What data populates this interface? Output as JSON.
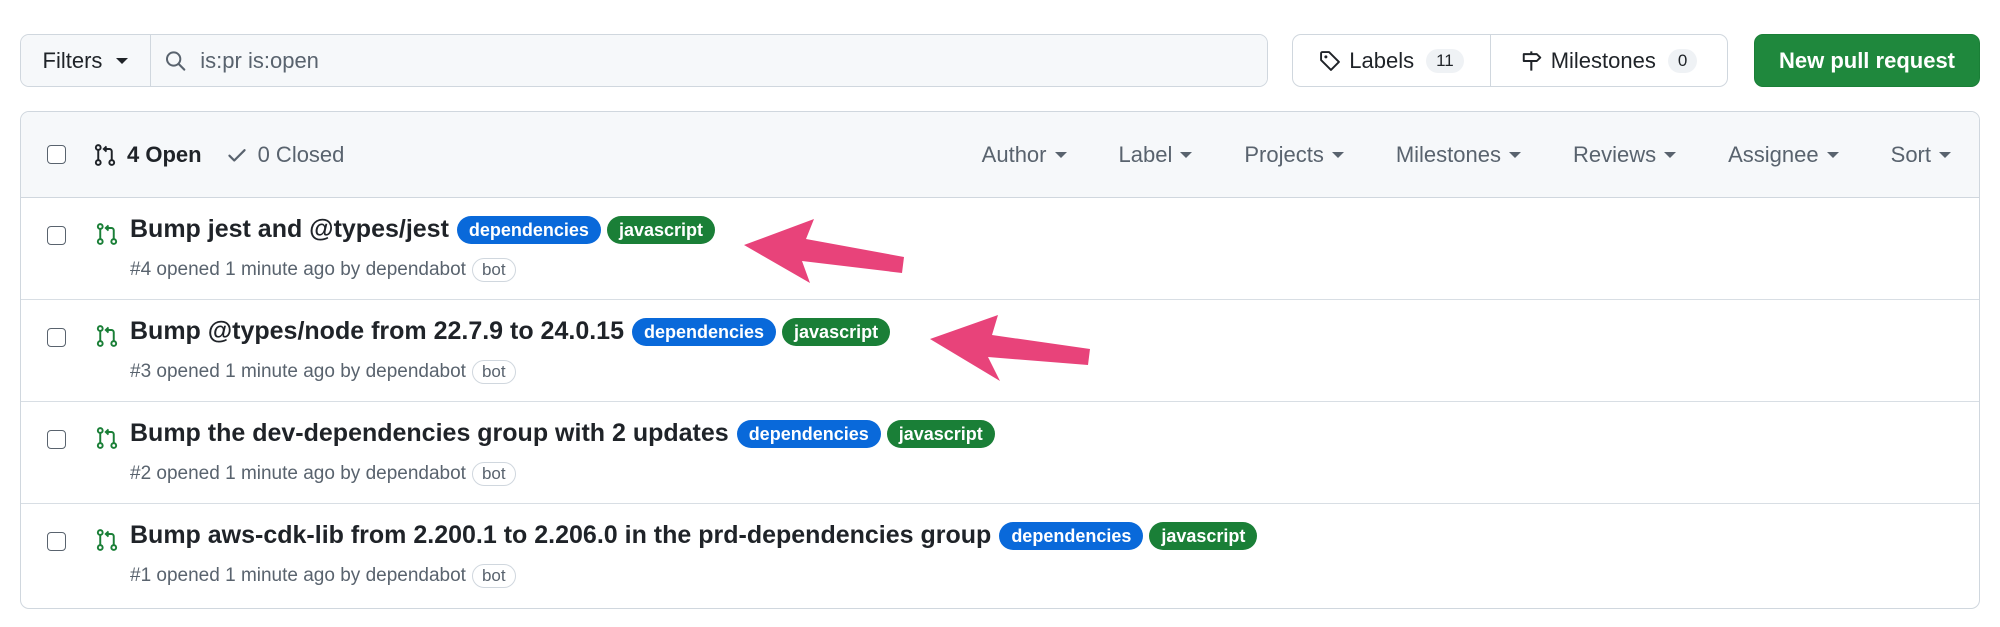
{
  "toolbar": {
    "filters_label": "Filters",
    "search_value": "is:pr is:open",
    "labels_label": "Labels",
    "labels_count": "11",
    "milestones_label": "Milestones",
    "milestones_count": "0",
    "new_pr_label": "New pull request"
  },
  "header": {
    "open_label": "4 Open",
    "closed_label": "0 Closed",
    "menus": [
      "Author",
      "Label",
      "Projects",
      "Milestones",
      "Reviews",
      "Assignee",
      "Sort"
    ]
  },
  "pull_requests": [
    {
      "title": "Bump jest and @types/jest",
      "labels": [
        "dependencies",
        "javascript"
      ],
      "meta": "#4 opened 1 minute ago by dependabot",
      "badge": "bot"
    },
    {
      "title": "Bump @types/node from 22.7.9 to 24.0.15",
      "labels": [
        "dependencies",
        "javascript"
      ],
      "meta": "#3 opened 1 minute ago by dependabot",
      "badge": "bot"
    },
    {
      "title": "Bump the dev-dependencies group with 2 updates",
      "labels": [
        "dependencies",
        "javascript"
      ],
      "meta": "#2 opened 1 minute ago by dependabot",
      "badge": "bot"
    },
    {
      "title": "Bump aws-cdk-lib from 2.200.1 to 2.206.0 in the prd-dependencies group",
      "labels": [
        "dependencies",
        "javascript"
      ],
      "meta": "#1 opened 1 minute ago by dependabot",
      "badge": "bot"
    }
  ],
  "colors": {
    "label_dependencies": "#0969da",
    "label_javascript": "#1a7f37",
    "pr_open_icon": "#1a7f37",
    "primary_button": "#1f883d",
    "annotation_arrow": "#e8437a"
  },
  "icons": {
    "search": "search-icon",
    "tag": "tag-icon",
    "milestone": "milestone-icon",
    "pull_request": "git-pull-request-icon",
    "check": "check-icon"
  }
}
